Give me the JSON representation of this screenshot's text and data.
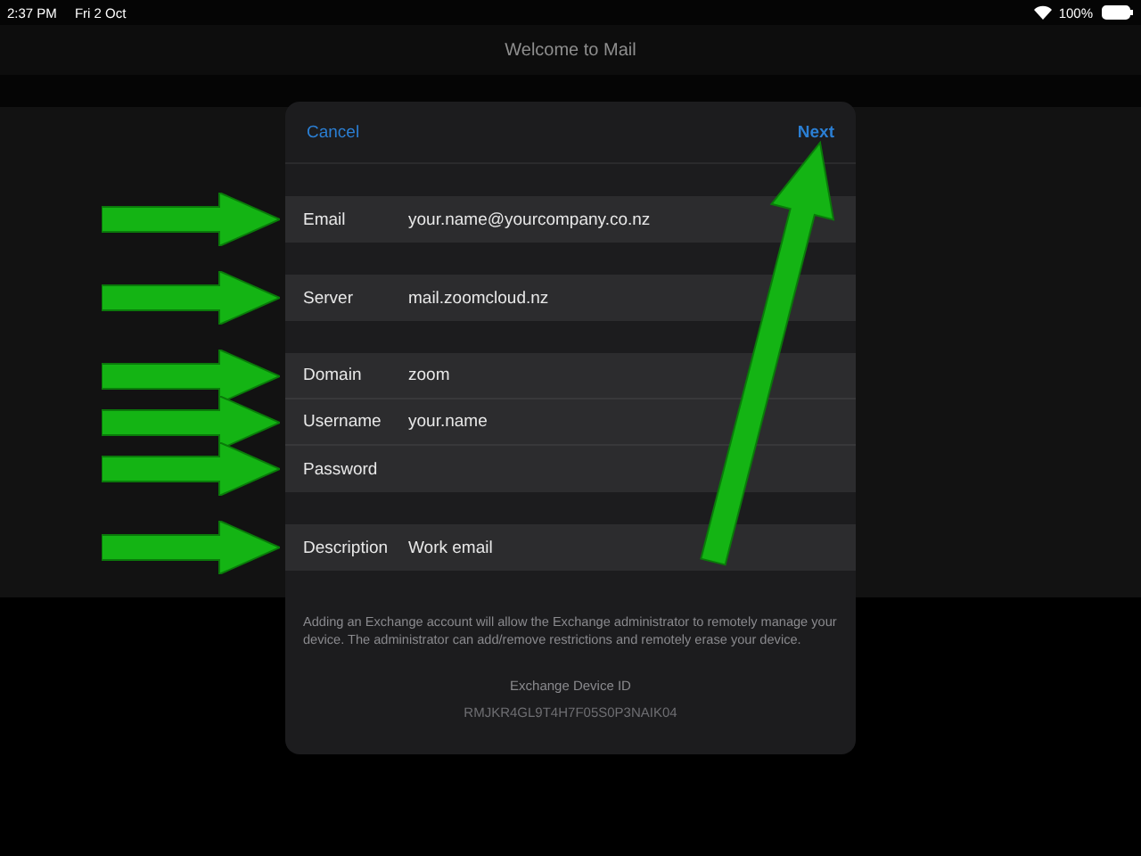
{
  "status_bar": {
    "time": "2:37 PM",
    "date": "Fri 2 Oct",
    "battery": "100%"
  },
  "header": {
    "title": "Welcome to Mail"
  },
  "dialog": {
    "cancel": "Cancel",
    "next": {
      "label": "Next",
      "pointed": true
    },
    "groups": [
      {
        "rows": [
          {
            "label": "Email",
            "value": "your.name@yourcompany.co.nz",
            "pointed": true
          }
        ]
      },
      {
        "rows": [
          {
            "label": "Server",
            "value": "mail.zoomcloud.nz",
            "pointed": true
          }
        ]
      },
      {
        "rows": [
          {
            "label": "Domain",
            "value": "zoom",
            "pointed": true
          },
          {
            "label": "Username",
            "value": "your.name",
            "pointed": true
          },
          {
            "label": "Password",
            "pointed": true
          }
        ]
      },
      {
        "rows": [
          {
            "label": "Description",
            "value": "Work email",
            "pointed": true
          }
        ]
      }
    ],
    "note": "Adding an Exchange account will allow the Exchange administrator to remotely manage your device. The administrator can add/remove restrictions and remotely erase your device.",
    "device_id_label": "Exchange Device ID",
    "device_id": "RMJKR4GL9T4H7F05S0P3NAIK04"
  }
}
